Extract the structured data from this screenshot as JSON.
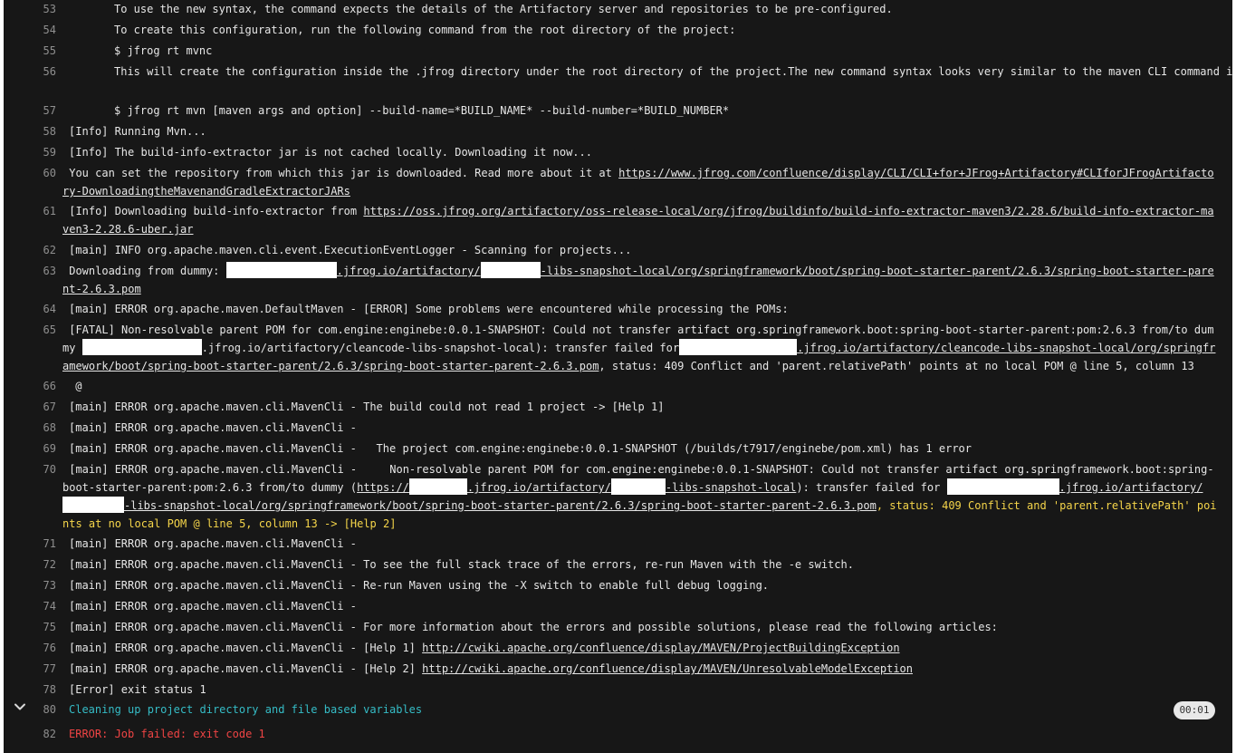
{
  "log": {
    "l53": {
      "n": "53",
      "t": "To use the new syntax, the command expects the details of the Artifactory server and repositories to be pre-configured."
    },
    "l54": {
      "n": "54",
      "t": "To create this configuration, run the following command from the root directory of the project:"
    },
    "l55": {
      "n": "55",
      "t": "$ jfrog rt mvnc"
    },
    "l56": {
      "n": "56",
      "t": "This will create the configuration inside the .jfrog directory under the root directory of the project.The new command syntax looks very similar to the maven CLI command i.e.:"
    },
    "l57": {
      "n": "57",
      "t": "$ jfrog rt mvn [maven args and option] --build-name=*BUILD_NAME* --build-number=*BUILD_NUMBER*"
    },
    "l58": {
      "n": "58",
      "t": "[Info] Running Mvn..."
    },
    "l59": {
      "n": "59",
      "t": "[Info] The build-info-extractor jar is not cached locally. Downloading it now..."
    },
    "l60": {
      "n": "60",
      "pre": " You can set the repository from which this jar is downloaded. Read more about it at ",
      "link": "https://www.jfrog.com/confluence/display/CLI/CLI+for+JFrog+Artifactory#CLIforJFrogArtifactory-DownloadingtheMavenandGradleExtractorJARs"
    },
    "l61": {
      "n": "61",
      "pre": "[Info] Downloading build-info-extractor from ",
      "link": "https://oss.jfrog.org/artifactory/oss-release-local/org/jfrog/buildinfo/build-info-extractor-maven3/2.28.6/build-info-extractor-maven3-2.28.6-uber.jar"
    },
    "l62": {
      "n": "62",
      "t": "[main] INFO org.apache.maven.cli.event.ExecutionEventLogger - Scanning for projects..."
    },
    "l63": {
      "n": "63",
      "pre": "Downloading from dummy: ",
      "link_a": ".jfrog.io/artifactory/",
      "link_b": "-libs-snapshot-local/org/springframework/boot/spring-boot-starter-parent/2.6.3/spring-boot-starter-parent-2.6.3.pom"
    },
    "l64": {
      "n": "64",
      "t": "[main] ERROR org.apache.maven.DefaultMaven - [ERROR] Some problems were encountered while processing the POMs:"
    },
    "l65": {
      "n": "65",
      "pre": "[FATAL] Non-resolvable parent POM for com.engine:enginebe:0.0.1-SNAPSHOT: Could not transfer artifact org.springframework.boot:spring-boot-starter-parent:pom:2.6.3 from/to dummy ",
      "mid1": ".jfrog.io/artifactory/cleancode-libs-snapshot-local): transfer failed for",
      "link": ".jfrog.io/artifactory/cleancode-libs-snapshot-local/org/springframework/boot/spring-boot-starter-parent/2.6.3/spring-boot-starter-parent-2.6.3.pom",
      "post": ", status: 409 Conflict and 'parent.relativePath' points at no local POM @ line 5, column 13"
    },
    "l66": {
      "n": "66",
      "t": " @"
    },
    "l67": {
      "n": "67",
      "t": "[main] ERROR org.apache.maven.cli.MavenCli - The build could not read 1 project -> [Help 1]"
    },
    "l68": {
      "n": "68",
      "t": "[main] ERROR org.apache.maven.cli.MavenCli -"
    },
    "l69": {
      "n": "69",
      "t": "[main] ERROR org.apache.maven.cli.MavenCli -   The project com.engine:enginebe:0.0.1-SNAPSHOT (/builds/t7917/enginebe/pom.xml) has 1 error"
    },
    "l70": {
      "n": "70",
      "pre": "[main] ERROR org.apache.maven.cli.MavenCli -     Non-resolvable parent POM for com.engine:enginebe:0.0.1-SNAPSHOT: Could not transfer artifact org.springframework.boot:spring-boot-starter-parent:pom:2.6.3 from/to dummy (",
      "link1": "https://",
      "link1b": ".jfrog.io/artifactory/",
      "link1c": "-libs-snapshot-local",
      "mid": "): transfer failed for ",
      "link2": ".jfrog.io/artifactory/",
      "link2b": "-libs-snapshot-local/org/springframework/boot/spring-boot-starter-parent/2.6.3/spring-boot-starter-parent-2.6.3.pom",
      "post": ", status: 409 Conflict and 'parent.relativePath' points at no local POM @ line 5, column 13 -> [Help 2]"
    },
    "l71": {
      "n": "71",
      "t": "[main] ERROR org.apache.maven.cli.MavenCli -"
    },
    "l72": {
      "n": "72",
      "t": "[main] ERROR org.apache.maven.cli.MavenCli - To see the full stack trace of the errors, re-run Maven with the -e switch."
    },
    "l73": {
      "n": "73",
      "t": "[main] ERROR org.apache.maven.cli.MavenCli - Re-run Maven using the -X switch to enable full debug logging."
    },
    "l74": {
      "n": "74",
      "t": "[main] ERROR org.apache.maven.cli.MavenCli -"
    },
    "l75": {
      "n": "75",
      "t": "[main] ERROR org.apache.maven.cli.MavenCli - For more information about the errors and possible solutions, please read the following articles:"
    },
    "l76": {
      "n": "76",
      "pre": "[main] ERROR org.apache.maven.cli.MavenCli - [Help 1] ",
      "link": "http://cwiki.apache.org/confluence/display/MAVEN/ProjectBuildingException"
    },
    "l77": {
      "n": "77",
      "pre": "[main] ERROR org.apache.maven.cli.MavenCli - [Help 2] ",
      "link": "http://cwiki.apache.org/confluence/display/MAVEN/UnresolvableModelException"
    },
    "l78": {
      "n": "78",
      "t": "[Error] exit status 1"
    },
    "l80": {
      "n": "80",
      "t": "Cleaning up project directory and file based variables"
    },
    "l82": {
      "n": "82",
      "t": "ERROR: Job failed: exit code 1"
    }
  },
  "section": {
    "duration": "00:01",
    "toggle_icon": "chevron-down-icon"
  },
  "colors": {
    "background": "#171717",
    "text": "#e6e6e6",
    "line_number": "#8f8f8f",
    "error": "#ef4444",
    "section_header": "#35bcc6",
    "warning": "#f5d54a"
  }
}
